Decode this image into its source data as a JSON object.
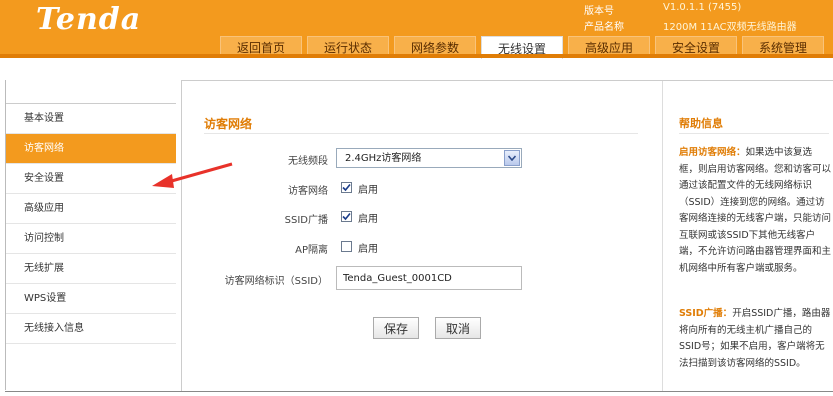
{
  "header": {
    "logo": "Tenda",
    "version_label": "版本号",
    "version_value": "V1.0.1.1 (7455)",
    "product_label": "产品名称",
    "product_value": "1200M 11AC双频无线路由器"
  },
  "tabs": [
    {
      "label": "返回首页",
      "active": false
    },
    {
      "label": "运行状态",
      "active": false
    },
    {
      "label": "网络参数",
      "active": false
    },
    {
      "label": "无线设置",
      "active": true
    },
    {
      "label": "高级应用",
      "active": false
    },
    {
      "label": "安全设置",
      "active": false
    },
    {
      "label": "系统管理",
      "active": false
    }
  ],
  "sidebar": {
    "items": [
      {
        "label": "基本设置",
        "active": false
      },
      {
        "label": "访客网络",
        "active": true
      },
      {
        "label": "安全设置",
        "active": false
      },
      {
        "label": "高级应用",
        "active": false
      },
      {
        "label": "访问控制",
        "active": false
      },
      {
        "label": "无线扩展",
        "active": false
      },
      {
        "label": "WPS设置",
        "active": false
      },
      {
        "label": "无线接入信息",
        "active": false
      }
    ]
  },
  "form": {
    "title": "访客网络",
    "band_label": "无线频段",
    "band_value": "2.4GHz访客网络",
    "guest_label": "访客网络",
    "guest_enable": "启用",
    "ssid_broadcast_label": "SSID广播",
    "ssid_broadcast_enable": "启用",
    "ap_isolation_label": "AP隔离",
    "ap_isolation_enable": "启用",
    "ssid_label": "访客网络标识（SSID）",
    "ssid_value": "Tenda_Guest_0001CD",
    "save_label": "保存",
    "cancel_label": "取消"
  },
  "help": {
    "title": "帮助信息",
    "p1_key": "启用访客网络：",
    "p1_text": "如果选中该复选框，则启用访客网络。您和访客可以通过该配置文件的无线网络标识（SSID）连接到您的网络。通过访客网络连接的无线客户端，只能访问互联网或该SSID下其他无线客户端，不允许访问路由器管理界面和主机网络中所有客户端或服务。",
    "p2_key": "SSID广播：",
    "p2_text": "开启SSID广播，路由器将向所有的无线主机广播自己的SSID号；如果不启用，客户端将无法扫描到该访客网络的SSID。"
  },
  "colors": {
    "brand_orange": "#f39a1e",
    "accent_text": "#e07d06",
    "arrow": "#e8322a"
  }
}
